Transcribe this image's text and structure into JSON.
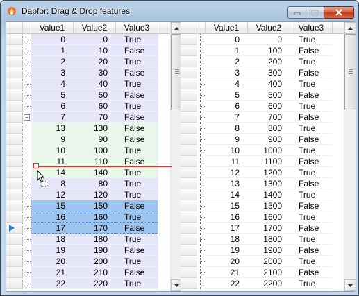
{
  "window": {
    "title": "Dapfor: Drag & Drop features"
  },
  "columns": [
    "Value1",
    "Value2",
    "Value3"
  ],
  "left_grid": {
    "rows": [
      {
        "v1": "0",
        "v2": "0",
        "v3": "True",
        "kind": "norm",
        "level": 0
      },
      {
        "v1": "1",
        "v2": "10",
        "v3": "False",
        "kind": "norm",
        "level": 0
      },
      {
        "v1": "2",
        "v2": "20",
        "v3": "True",
        "kind": "norm",
        "level": 0
      },
      {
        "v1": "3",
        "v2": "30",
        "v3": "False",
        "kind": "norm",
        "level": 0
      },
      {
        "v1": "4",
        "v2": "40",
        "v3": "True",
        "kind": "norm",
        "level": 0
      },
      {
        "v1": "5",
        "v2": "50",
        "v3": "False",
        "kind": "norm",
        "level": 0
      },
      {
        "v1": "6",
        "v2": "60",
        "v3": "True",
        "kind": "norm",
        "level": 0
      },
      {
        "v1": "7",
        "v2": "70",
        "v3": "False",
        "kind": "norm",
        "level": 0,
        "expander": "−"
      },
      {
        "v1": "13",
        "v2": "130",
        "v3": "False",
        "kind": "green",
        "level": 1
      },
      {
        "v1": "9",
        "v2": "90",
        "v3": "False",
        "kind": "green",
        "level": 1
      },
      {
        "v1": "10",
        "v2": "100",
        "v3": "True",
        "kind": "green",
        "level": 1
      },
      {
        "v1": "11",
        "v2": "110",
        "v3": "False",
        "kind": "green",
        "level": 1
      },
      {
        "v1": "14",
        "v2": "140",
        "v3": "True",
        "kind": "green",
        "level": 1
      },
      {
        "v1": "8",
        "v2": "80",
        "v3": "True",
        "kind": "norm",
        "level": 0
      },
      {
        "v1": "12",
        "v2": "120",
        "v3": "True",
        "kind": "norm",
        "level": 0
      },
      {
        "v1": "15",
        "v2": "150",
        "v3": "False",
        "kind": "sel-blue",
        "level": 0
      },
      {
        "v1": "16",
        "v2": "160",
        "v3": "True",
        "kind": "sel-blue",
        "level": 0
      },
      {
        "v1": "17",
        "v2": "170",
        "v3": "False",
        "kind": "sel-blue",
        "level": 0,
        "current": true
      },
      {
        "v1": "18",
        "v2": "180",
        "v3": "True",
        "kind": "norm",
        "level": 0
      },
      {
        "v1": "19",
        "v2": "190",
        "v3": "False",
        "kind": "norm",
        "level": 0
      },
      {
        "v1": "20",
        "v2": "200",
        "v3": "True",
        "kind": "norm",
        "level": 0
      },
      {
        "v1": "21",
        "v2": "210",
        "v3": "False",
        "kind": "norm",
        "level": 0
      },
      {
        "v1": "22",
        "v2": "220",
        "v3": "True",
        "kind": "norm",
        "level": 0
      }
    ]
  },
  "right_grid": {
    "rows": [
      {
        "v1": "0",
        "v2": "0",
        "v3": "True"
      },
      {
        "v1": "1",
        "v2": "100",
        "v3": "False"
      },
      {
        "v1": "2",
        "v2": "200",
        "v3": "True"
      },
      {
        "v1": "3",
        "v2": "300",
        "v3": "False"
      },
      {
        "v1": "4",
        "v2": "400",
        "v3": "True"
      },
      {
        "v1": "5",
        "v2": "500",
        "v3": "False"
      },
      {
        "v1": "6",
        "v2": "600",
        "v3": "True"
      },
      {
        "v1": "7",
        "v2": "700",
        "v3": "False"
      },
      {
        "v1": "8",
        "v2": "800",
        "v3": "True"
      },
      {
        "v1": "9",
        "v2": "900",
        "v3": "False"
      },
      {
        "v1": "10",
        "v2": "1000",
        "v3": "True"
      },
      {
        "v1": "11",
        "v2": "1100",
        "v3": "False"
      },
      {
        "v1": "12",
        "v2": "1200",
        "v3": "True"
      },
      {
        "v1": "13",
        "v2": "1300",
        "v3": "False"
      },
      {
        "v1": "14",
        "v2": "1400",
        "v3": "True"
      },
      {
        "v1": "15",
        "v2": "1500",
        "v3": "False"
      },
      {
        "v1": "16",
        "v2": "1600",
        "v3": "True"
      },
      {
        "v1": "17",
        "v2": "1700",
        "v3": "False"
      },
      {
        "v1": "18",
        "v2": "1800",
        "v3": "True"
      },
      {
        "v1": "19",
        "v2": "1900",
        "v3": "False"
      },
      {
        "v1": "20",
        "v2": "2000",
        "v3": "True"
      },
      {
        "v1": "21",
        "v2": "2100",
        "v3": "False"
      },
      {
        "v1": "22",
        "v2": "2200",
        "v3": "True"
      }
    ]
  },
  "icons": {
    "app": "drag-drop-app-icon",
    "minimize": "minimize-icon",
    "maximize": "maximize-icon",
    "close": "close-icon",
    "current_row": "current-row-arrow-icon",
    "drag_cursor": "drag-cursor-icon"
  },
  "colors": {
    "row_normal": "#e6e6fa",
    "row_dragged": "#e8f8e8",
    "row_selected": "#9cc4ee",
    "drop_indicator": "#dd3333"
  }
}
